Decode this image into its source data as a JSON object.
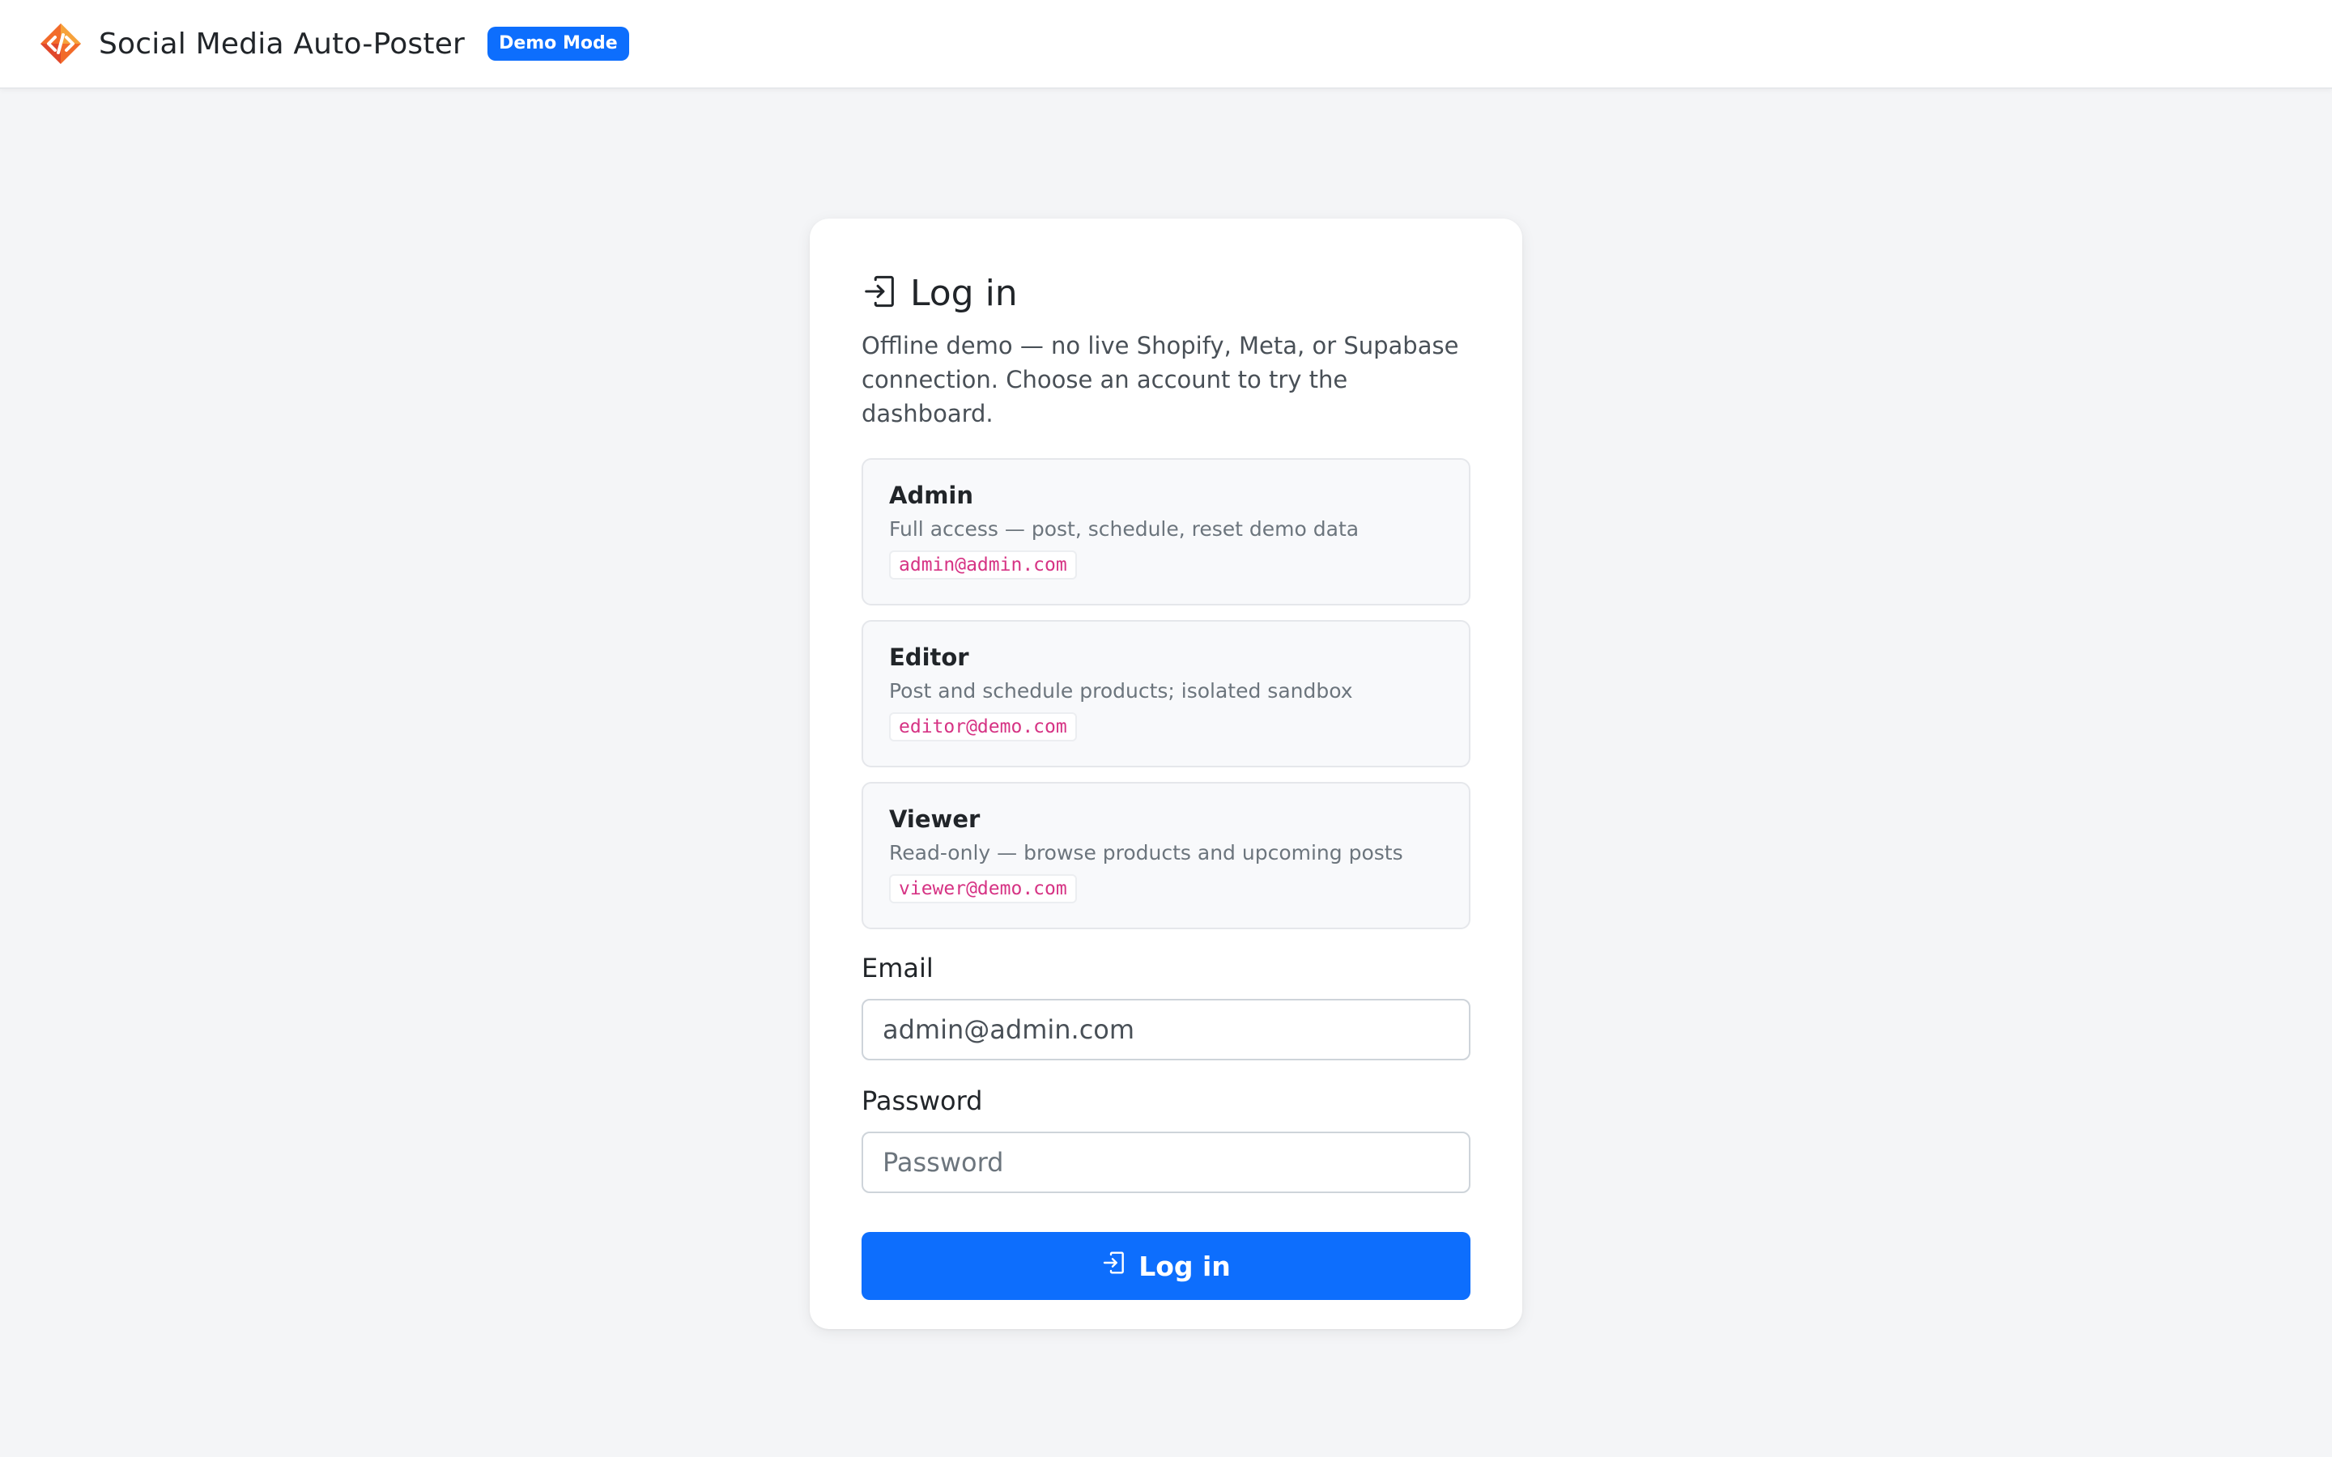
{
  "header": {
    "logo_icon": "code-diamond-logo-icon",
    "title": "Social Media Auto-Poster",
    "badge": "Demo Mode"
  },
  "login": {
    "heading_icon": "sign-in-icon",
    "title": "Log in",
    "subtitle": "Offline demo — no live Shopify, Meta, or Supabase connection. Choose an account to try the dashboard.",
    "accounts": [
      {
        "name": "Admin",
        "description": "Full access — post, schedule, reset demo data",
        "email": "admin@admin.com"
      },
      {
        "name": "Editor",
        "description": "Post and schedule products; isolated sandbox",
        "email": "editor@demo.com"
      },
      {
        "name": "Viewer",
        "description": "Read-only — browse products and upcoming posts",
        "email": "viewer@demo.com"
      }
    ],
    "email_label": "Email",
    "email_value": "admin@admin.com",
    "password_label": "Password",
    "password_placeholder": "Password",
    "submit_label": "Log in",
    "submit_icon": "sign-in-icon"
  },
  "colors": {
    "accent": "#0d6efd",
    "page_background": "#f4f5f7",
    "code_text": "#d63384"
  }
}
